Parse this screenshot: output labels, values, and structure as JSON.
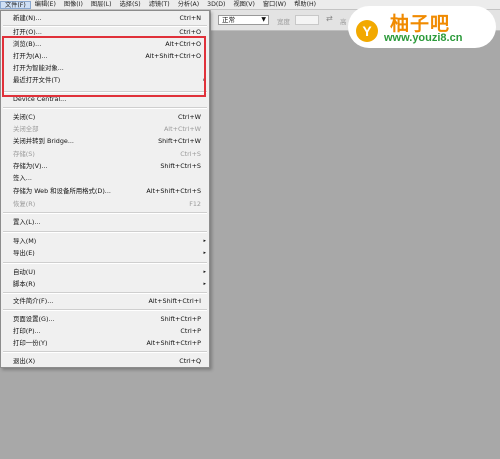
{
  "menubar": [
    {
      "label": "文件(F)"
    },
    {
      "label": "编辑(E)"
    },
    {
      "label": "图像(I)"
    },
    {
      "label": "图层(L)"
    },
    {
      "label": "选择(S)"
    },
    {
      "label": "滤镜(T)"
    },
    {
      "label": "分析(A)"
    },
    {
      "label": "3D(D)"
    },
    {
      "label": "视图(V)"
    },
    {
      "label": "窗口(W)"
    },
    {
      "label": "帮助(H)"
    }
  ],
  "options_bar": {
    "style_select": "正常",
    "width_label": "宽度",
    "height_label": "高"
  },
  "file_menu": [
    {
      "label": "新建(N)...",
      "shortcut": "Ctrl+N"
    },
    {
      "label": "打开(O)...",
      "shortcut": "Ctrl+O"
    },
    {
      "label": "浏览(B)...",
      "shortcut": "Alt+Ctrl+O"
    },
    {
      "label": "打开为(A)...",
      "shortcut": "Alt+Shift+Ctrl+O"
    },
    {
      "label": "打开为智能对象...",
      "shortcut": ""
    },
    {
      "label": "最近打开文件(T)",
      "shortcut": "",
      "submenu": true
    },
    {
      "label": "Device Central...",
      "shortcut": ""
    },
    {
      "label": "关闭(C)",
      "shortcut": "Ctrl+W"
    },
    {
      "label": "关闭全部",
      "shortcut": "Alt+Ctrl+W",
      "disabled": true
    },
    {
      "label": "关闭并转到 Bridge...",
      "shortcut": "Shift+Ctrl+W"
    },
    {
      "label": "存储(S)",
      "shortcut": "Ctrl+S",
      "disabled": true
    },
    {
      "label": "存储为(V)...",
      "shortcut": "Shift+Ctrl+S"
    },
    {
      "label": "签入...",
      "shortcut": ""
    },
    {
      "label": "存储为 Web 和设备所用格式(D)...",
      "shortcut": "Alt+Shift+Ctrl+S"
    },
    {
      "label": "恢复(R)",
      "shortcut": "F12",
      "disabled": true
    },
    {
      "label": "置入(L)...",
      "shortcut": ""
    },
    {
      "label": "导入(M)",
      "shortcut": "",
      "submenu": true
    },
    {
      "label": "导出(E)",
      "shortcut": "",
      "submenu": true
    },
    {
      "label": "自动(U)",
      "shortcut": "",
      "submenu": true
    },
    {
      "label": "脚本(R)",
      "shortcut": "",
      "submenu": true
    },
    {
      "label": "文件简介(F)...",
      "shortcut": "Alt+Shift+Ctrl+I"
    },
    {
      "label": "页面设置(G)...",
      "shortcut": "Shift+Ctrl+P"
    },
    {
      "label": "打印(P)...",
      "shortcut": "Ctrl+P"
    },
    {
      "label": "打印一份(Y)",
      "shortcut": "Alt+Shift+Ctrl+P"
    },
    {
      "label": "退出(X)",
      "shortcut": "Ctrl+Q"
    }
  ],
  "submenu_arrow": "▸",
  "watermark": {
    "icon_letter": "Y",
    "title": "柚子吧",
    "url": "www.youzi8.cn"
  },
  "colors": {
    "highlight_border": "#e0313a",
    "workspace": "#a8a8a8",
    "menu_bg": "#f0f0f0",
    "logo_orange": "#f08a00",
    "logo_green": "#2b9a3a"
  }
}
